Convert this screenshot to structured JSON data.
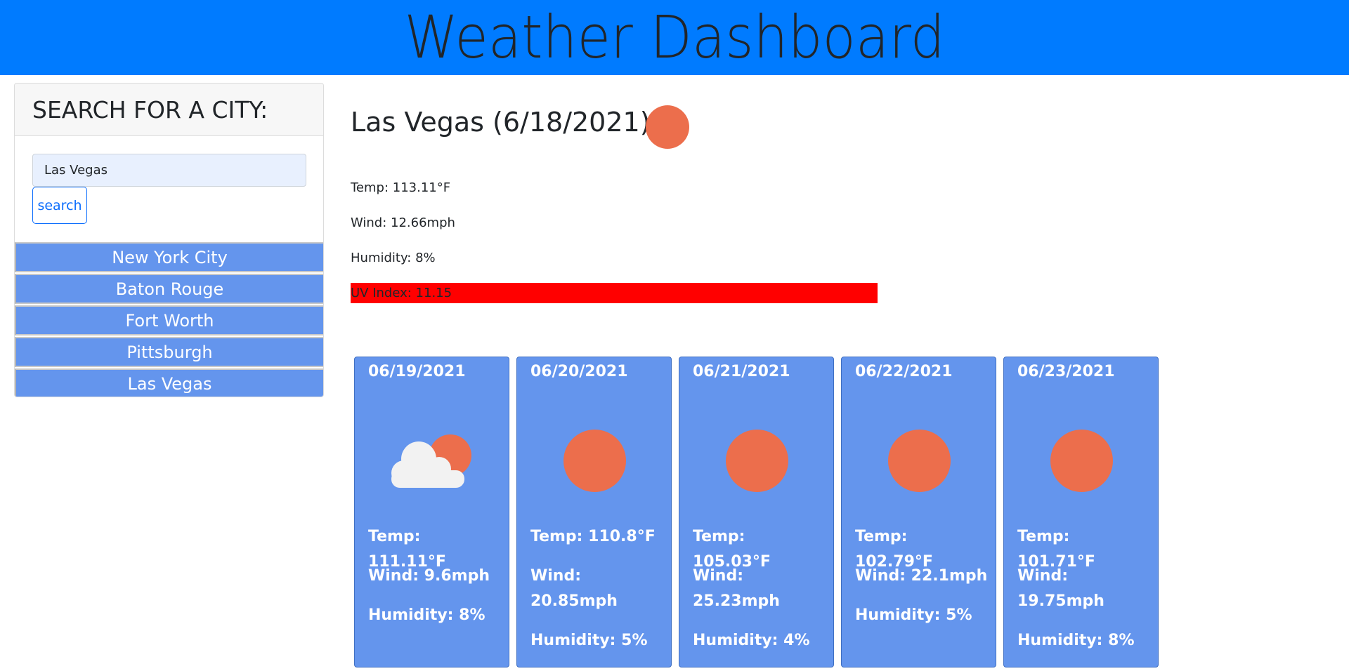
{
  "header": {
    "title": "Weather Dashboard"
  },
  "sidebar": {
    "heading": "SEARCH FOR A CITY:",
    "search": {
      "value": "Las Vegas",
      "placeholder": "",
      "button_label": "search"
    },
    "history": [
      {
        "label": "New York City"
      },
      {
        "label": "Baton Rouge"
      },
      {
        "label": "Fort Worth"
      },
      {
        "label": "Pittsburgh"
      },
      {
        "label": "Las Vegas"
      }
    ]
  },
  "current": {
    "title": "Las Vegas (6/18/2021)",
    "icon": "sun-icon",
    "temp": "Temp: 113.11°F",
    "wind": "Wind: 12.66mph",
    "humidity": "Humidity: 8%",
    "uv": "UV Index: 11.15",
    "uv_color": "#ff0000"
  },
  "forecast": [
    {
      "date": "06/19/2021",
      "icon": "partly-cloudy-icon",
      "temp": "Temp: 111.11°F",
      "wind": "Wind: 9.6mph",
      "humidity": "Humidity: 8%"
    },
    {
      "date": "06/20/2021",
      "icon": "sun-icon",
      "temp": "Temp: 110.8°F",
      "wind": "Wind: 20.85mph",
      "humidity": "Humidity: 5%"
    },
    {
      "date": "06/21/2021",
      "icon": "sun-icon",
      "temp": "Temp: 105.03°F",
      "wind": "Wind: 25.23mph",
      "humidity": "Humidity: 4%"
    },
    {
      "date": "06/22/2021",
      "icon": "sun-icon",
      "temp": "Temp: 102.79°F",
      "wind": "Wind: 22.1mph",
      "humidity": "Humidity: 5%"
    },
    {
      "date": "06/23/2021",
      "icon": "sun-icon",
      "temp": "Temp: 101.71°F",
      "wind": "Wind: 19.75mph",
      "humidity": "Humidity: 8%"
    }
  ],
  "colors": {
    "header_bg": "#007bff",
    "card_bg": "#6495ed",
    "sun": "#ec6e4c",
    "button_border": "#0d6efd"
  }
}
